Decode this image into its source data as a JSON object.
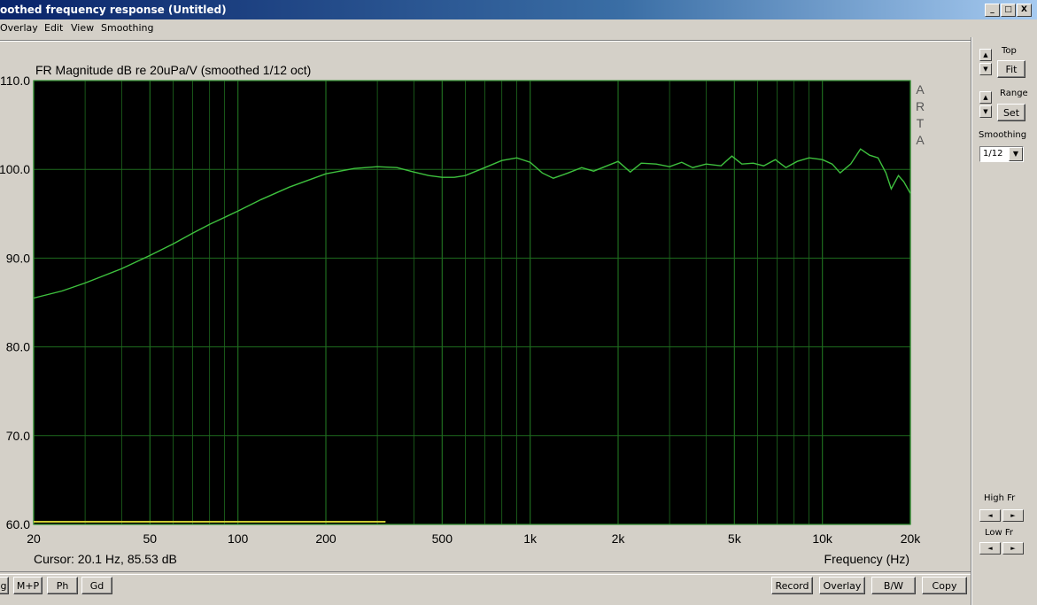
{
  "window": {
    "title": "oothed frequency response (Untitled)",
    "min_btn": "_",
    "max_btn": "□",
    "close_btn": "X"
  },
  "menu": [
    "Overlay",
    "Edit",
    "View",
    "Smoothing"
  ],
  "chart_data": {
    "type": "line",
    "title": "FR Magnitude dB re 20uPa/V (smoothed 1/12 oct)",
    "xlabel": "Frequency (Hz)",
    "x_scale": "log",
    "xlim": [
      20,
      20000
    ],
    "ylim": [
      60,
      110
    ],
    "x_ticks": [
      {
        "v": 20,
        "label": "20"
      },
      {
        "v": 50,
        "label": "50"
      },
      {
        "v": 100,
        "label": "100"
      },
      {
        "v": 200,
        "label": "200"
      },
      {
        "v": 500,
        "label": "500"
      },
      {
        "v": 1000,
        "label": "1k"
      },
      {
        "v": 2000,
        "label": "2k"
      },
      {
        "v": 5000,
        "label": "5k"
      },
      {
        "v": 10000,
        "label": "10k"
      },
      {
        "v": 20000,
        "label": "20k"
      }
    ],
    "y_ticks": [
      {
        "v": 110,
        "label": "110.0"
      },
      {
        "v": 100,
        "label": "100.0"
      },
      {
        "v": 90,
        "label": "90.0"
      },
      {
        "v": 80,
        "label": "80.0"
      },
      {
        "v": 70,
        "label": "70.0"
      },
      {
        "v": 60,
        "label": "60.0"
      }
    ],
    "brand": "ARTA",
    "grid": true,
    "colors": {
      "background": "#000000",
      "grid": "#1e6b1e",
      "curve": "#3ec13e",
      "axis": "#2f8f2f",
      "marker": "#cccc33"
    },
    "series": [
      {
        "points": [
          [
            20,
            85.5
          ],
          [
            25,
            86.3
          ],
          [
            30,
            87.2
          ],
          [
            40,
            88.8
          ],
          [
            50,
            90.3
          ],
          [
            60,
            91.6
          ],
          [
            70,
            92.8
          ],
          [
            80,
            93.8
          ],
          [
            100,
            95.3
          ],
          [
            120,
            96.6
          ],
          [
            150,
            98.0
          ],
          [
            200,
            99.5
          ],
          [
            250,
            100.1
          ],
          [
            300,
            100.3
          ],
          [
            350,
            100.2
          ],
          [
            400,
            99.7
          ],
          [
            450,
            99.3
          ],
          [
            500,
            99.1
          ],
          [
            550,
            99.1
          ],
          [
            600,
            99.3
          ],
          [
            700,
            100.2
          ],
          [
            800,
            101.0
          ],
          [
            900,
            101.3
          ],
          [
            1000,
            100.8
          ],
          [
            1100,
            99.6
          ],
          [
            1200,
            99.0
          ],
          [
            1350,
            99.6
          ],
          [
            1500,
            100.2
          ],
          [
            1650,
            99.8
          ],
          [
            1800,
            100.3
          ],
          [
            2000,
            100.9
          ],
          [
            2200,
            99.7
          ],
          [
            2400,
            100.7
          ],
          [
            2700,
            100.6
          ],
          [
            3000,
            100.3
          ],
          [
            3300,
            100.8
          ],
          [
            3600,
            100.2
          ],
          [
            4000,
            100.6
          ],
          [
            4500,
            100.4
          ],
          [
            4900,
            101.5
          ],
          [
            5300,
            100.6
          ],
          [
            5800,
            100.7
          ],
          [
            6300,
            100.4
          ],
          [
            6900,
            101.1
          ],
          [
            7500,
            100.2
          ],
          [
            8200,
            100.9
          ],
          [
            9000,
            101.3
          ],
          [
            10000,
            101.1
          ],
          [
            10800,
            100.6
          ],
          [
            11500,
            99.6
          ],
          [
            12500,
            100.6
          ],
          [
            13500,
            102.3
          ],
          [
            14500,
            101.6
          ],
          [
            15500,
            101.3
          ],
          [
            16500,
            99.6
          ],
          [
            17200,
            97.8
          ],
          [
            18200,
            99.3
          ],
          [
            19000,
            98.6
          ],
          [
            20000,
            97.3
          ]
        ]
      }
    ],
    "marker": {
      "x_from": 20,
      "x_to": 320,
      "y": 60
    }
  },
  "cursor_readout": "Cursor: 20.1 Hz, 85.53 dB",
  "bottom_left_buttons": [
    "g",
    "M+P",
    "Ph",
    "Gd"
  ],
  "bottom_right_buttons": [
    "Record",
    "Overlay",
    "B/W",
    "Copy"
  ],
  "side": {
    "top_label": "Top",
    "fit_btn": "Fit",
    "range_label": "Range",
    "set_btn": "Set",
    "smoothing_label": "Smoothing",
    "smoothing_value": "1/12",
    "high_fr_label": "High Fr",
    "low_fr_label": "Low Fr"
  },
  "glyphs": {
    "up": "▲",
    "down": "▼",
    "left": "◄",
    "right": "►"
  }
}
